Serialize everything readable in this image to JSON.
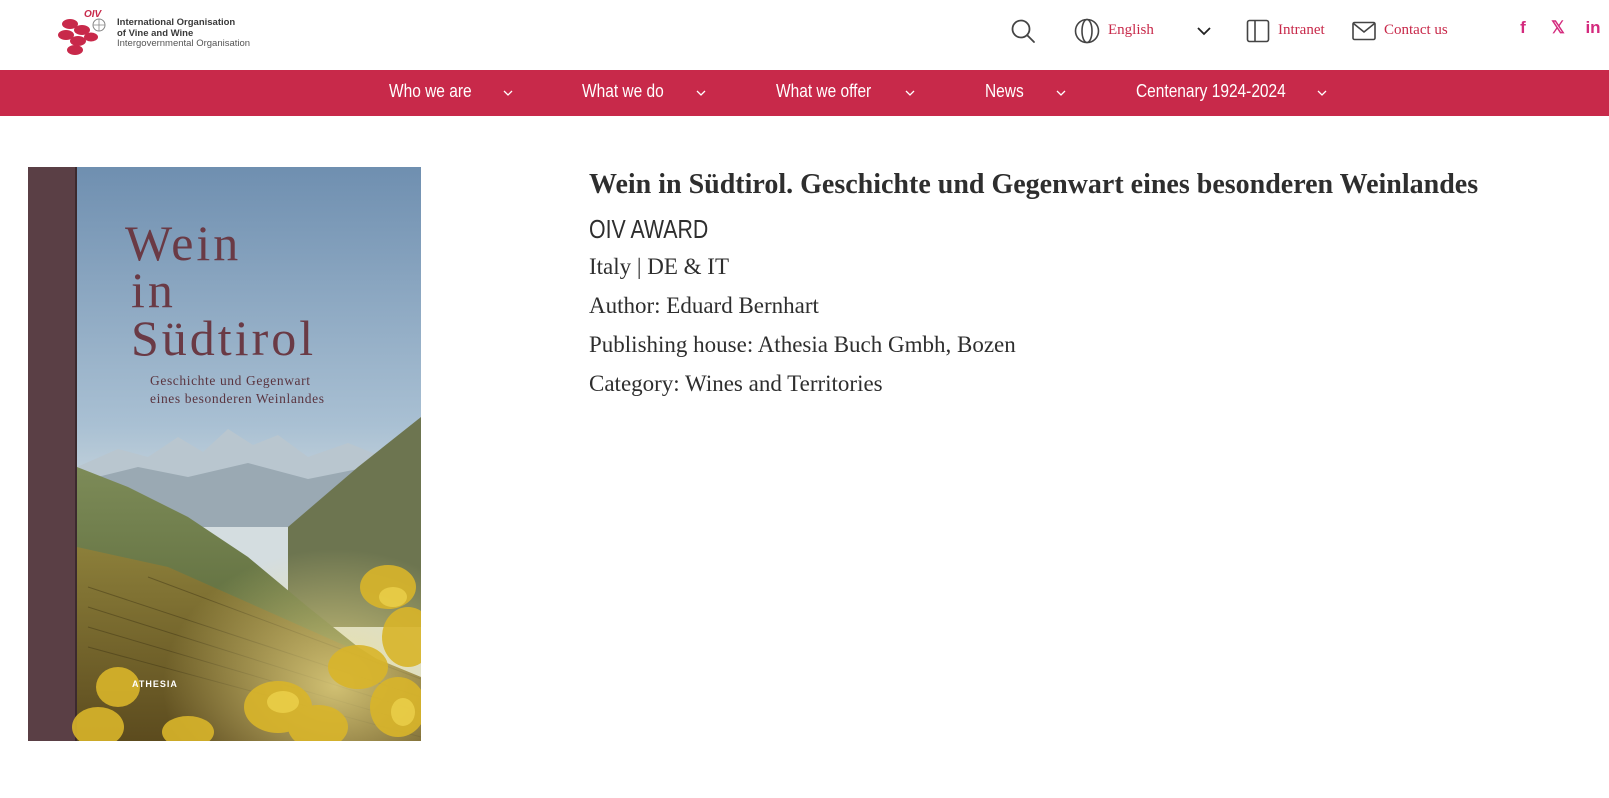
{
  "header": {
    "logo": {
      "mark_text": "OIV",
      "line1": "International Organisation",
      "line2": "of Vine and Wine",
      "line3": "Intergovernmental Organisation"
    },
    "search_icon": "search-icon",
    "language": {
      "selected": "English",
      "icon": "globe-icon"
    },
    "intranet_label": "Intranet",
    "contact_label": "Contact us",
    "social": {
      "facebook": "f",
      "x": "𝕏",
      "linkedin": "in"
    }
  },
  "nav": {
    "items": [
      {
        "label": "Who we are"
      },
      {
        "label": "What we do"
      },
      {
        "label": "What we offer"
      },
      {
        "label": "News"
      },
      {
        "label": "Centenary 1924-2024"
      }
    ]
  },
  "book": {
    "cover": {
      "title_line1": "Wein",
      "title_line2": "in",
      "title_line3": "Südtirol",
      "subtitle_line1": "Geschichte und Gegenwart",
      "subtitle_line2": "eines besonderen Weinlandes",
      "publisher_mark": "ATHESIA"
    },
    "title": "Wein in Südtirol. Geschichte und Gegenwart eines besonderen Weinlandes",
    "award": "OIV AWARD",
    "country_lang": "Italy | DE & IT",
    "author": "Author:  Eduard Bernhart",
    "publisher": "Publishing house: Athesia Buch Gmbh, Bozen",
    "category": "Category: Wines and Territories"
  },
  "colors": {
    "brand": "#c8294a",
    "social": "#d42a7d",
    "text": "#2e2e2e"
  }
}
